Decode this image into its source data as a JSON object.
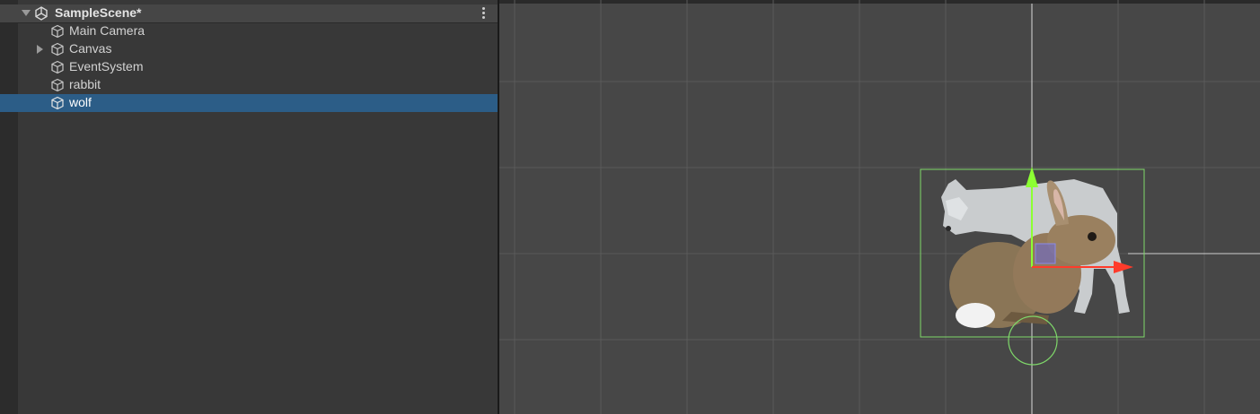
{
  "hierarchy": {
    "scene_title": "SampleScene*",
    "items": [
      {
        "label": "Main Camera",
        "has_children": false,
        "selected": false
      },
      {
        "label": "Canvas",
        "has_children": true,
        "selected": false
      },
      {
        "label": "EventSystem",
        "has_children": false,
        "selected": false
      },
      {
        "label": "rabbit",
        "has_children": false,
        "selected": false
      },
      {
        "label": "wolf",
        "has_children": false,
        "selected": true
      }
    ]
  },
  "colors": {
    "panel_bg": "#383838",
    "selection": "#2c5d87",
    "scene_bg": "#474747",
    "gizmo_y": "#8cff33",
    "gizmo_x": "#ff3b2b",
    "bounds": "#7fd86a"
  }
}
